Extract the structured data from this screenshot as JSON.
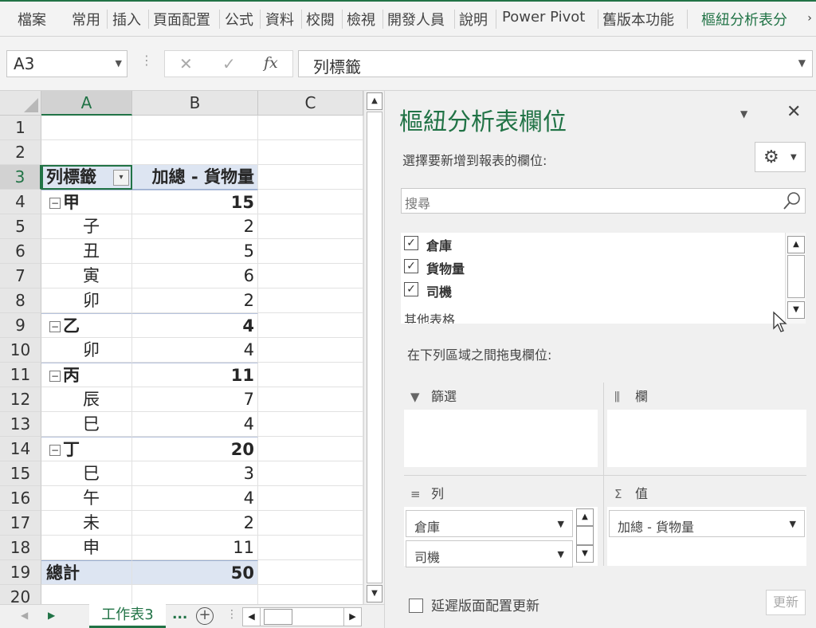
{
  "ribbon": {
    "tabs": [
      "檔案",
      "常用",
      "插入",
      "頁面配置",
      "公式",
      "資料",
      "校閱",
      "檢視",
      "開發人員",
      "說明",
      "Power Pivot",
      "舊版本功能",
      "樞紐分析表分"
    ],
    "accent": "#217346"
  },
  "formula_bar": {
    "name_box": "A3",
    "content": "列標籤",
    "fx": "fx"
  },
  "grid": {
    "columns": [
      "A",
      "B",
      "C"
    ],
    "rows": [
      "1",
      "2",
      "3",
      "4",
      "5",
      "6",
      "7",
      "8",
      "9",
      "10",
      "11",
      "12",
      "13",
      "14",
      "15",
      "16",
      "17",
      "18",
      "19",
      "20"
    ],
    "header_row": {
      "a": "列標籤",
      "b": "加總 - 貨物量"
    },
    "pivot_rows": [
      {
        "label": "甲",
        "value": "15",
        "type": "group"
      },
      {
        "label": "子",
        "value": "2",
        "type": "item"
      },
      {
        "label": "丑",
        "value": "5",
        "type": "item"
      },
      {
        "label": "寅",
        "value": "6",
        "type": "item"
      },
      {
        "label": "卯",
        "value": "2",
        "type": "item"
      },
      {
        "label": "乙",
        "value": "4",
        "type": "group"
      },
      {
        "label": "卯",
        "value": "4",
        "type": "item"
      },
      {
        "label": "丙",
        "value": "11",
        "type": "group"
      },
      {
        "label": "辰",
        "value": "7",
        "type": "item"
      },
      {
        "label": "巳",
        "value": "4",
        "type": "item"
      },
      {
        "label": "丁",
        "value": "20",
        "type": "group"
      },
      {
        "label": "巳",
        "value": "3",
        "type": "item"
      },
      {
        "label": "午",
        "value": "4",
        "type": "item"
      },
      {
        "label": "未",
        "value": "2",
        "type": "item"
      },
      {
        "label": "申",
        "value": "11",
        "type": "item"
      }
    ],
    "total_row": {
      "a": "總計",
      "b": "50"
    }
  },
  "sheet_tabs": {
    "active": "工作表3",
    "more": "..."
  },
  "pivot_pane": {
    "title": "樞紐分析表欄位",
    "choose_label": "選擇要新增到報表的欄位:",
    "search_placeholder": "搜尋",
    "fields": [
      {
        "label": "倉庫",
        "checked": true
      },
      {
        "label": "貨物量",
        "checked": true
      },
      {
        "label": "司機",
        "checked": true
      }
    ],
    "other_tables": "其他表格",
    "drag_label": "在下列區域之間拖曳欄位:",
    "areas": {
      "filters": "篩選",
      "columns": "欄",
      "rows": "列",
      "values": "值"
    },
    "row_fields": [
      "倉庫",
      "司機"
    ],
    "value_fields": [
      "加總 - 貨物量"
    ],
    "defer_label": "延遲版面配置更新",
    "update_button": "更新"
  }
}
